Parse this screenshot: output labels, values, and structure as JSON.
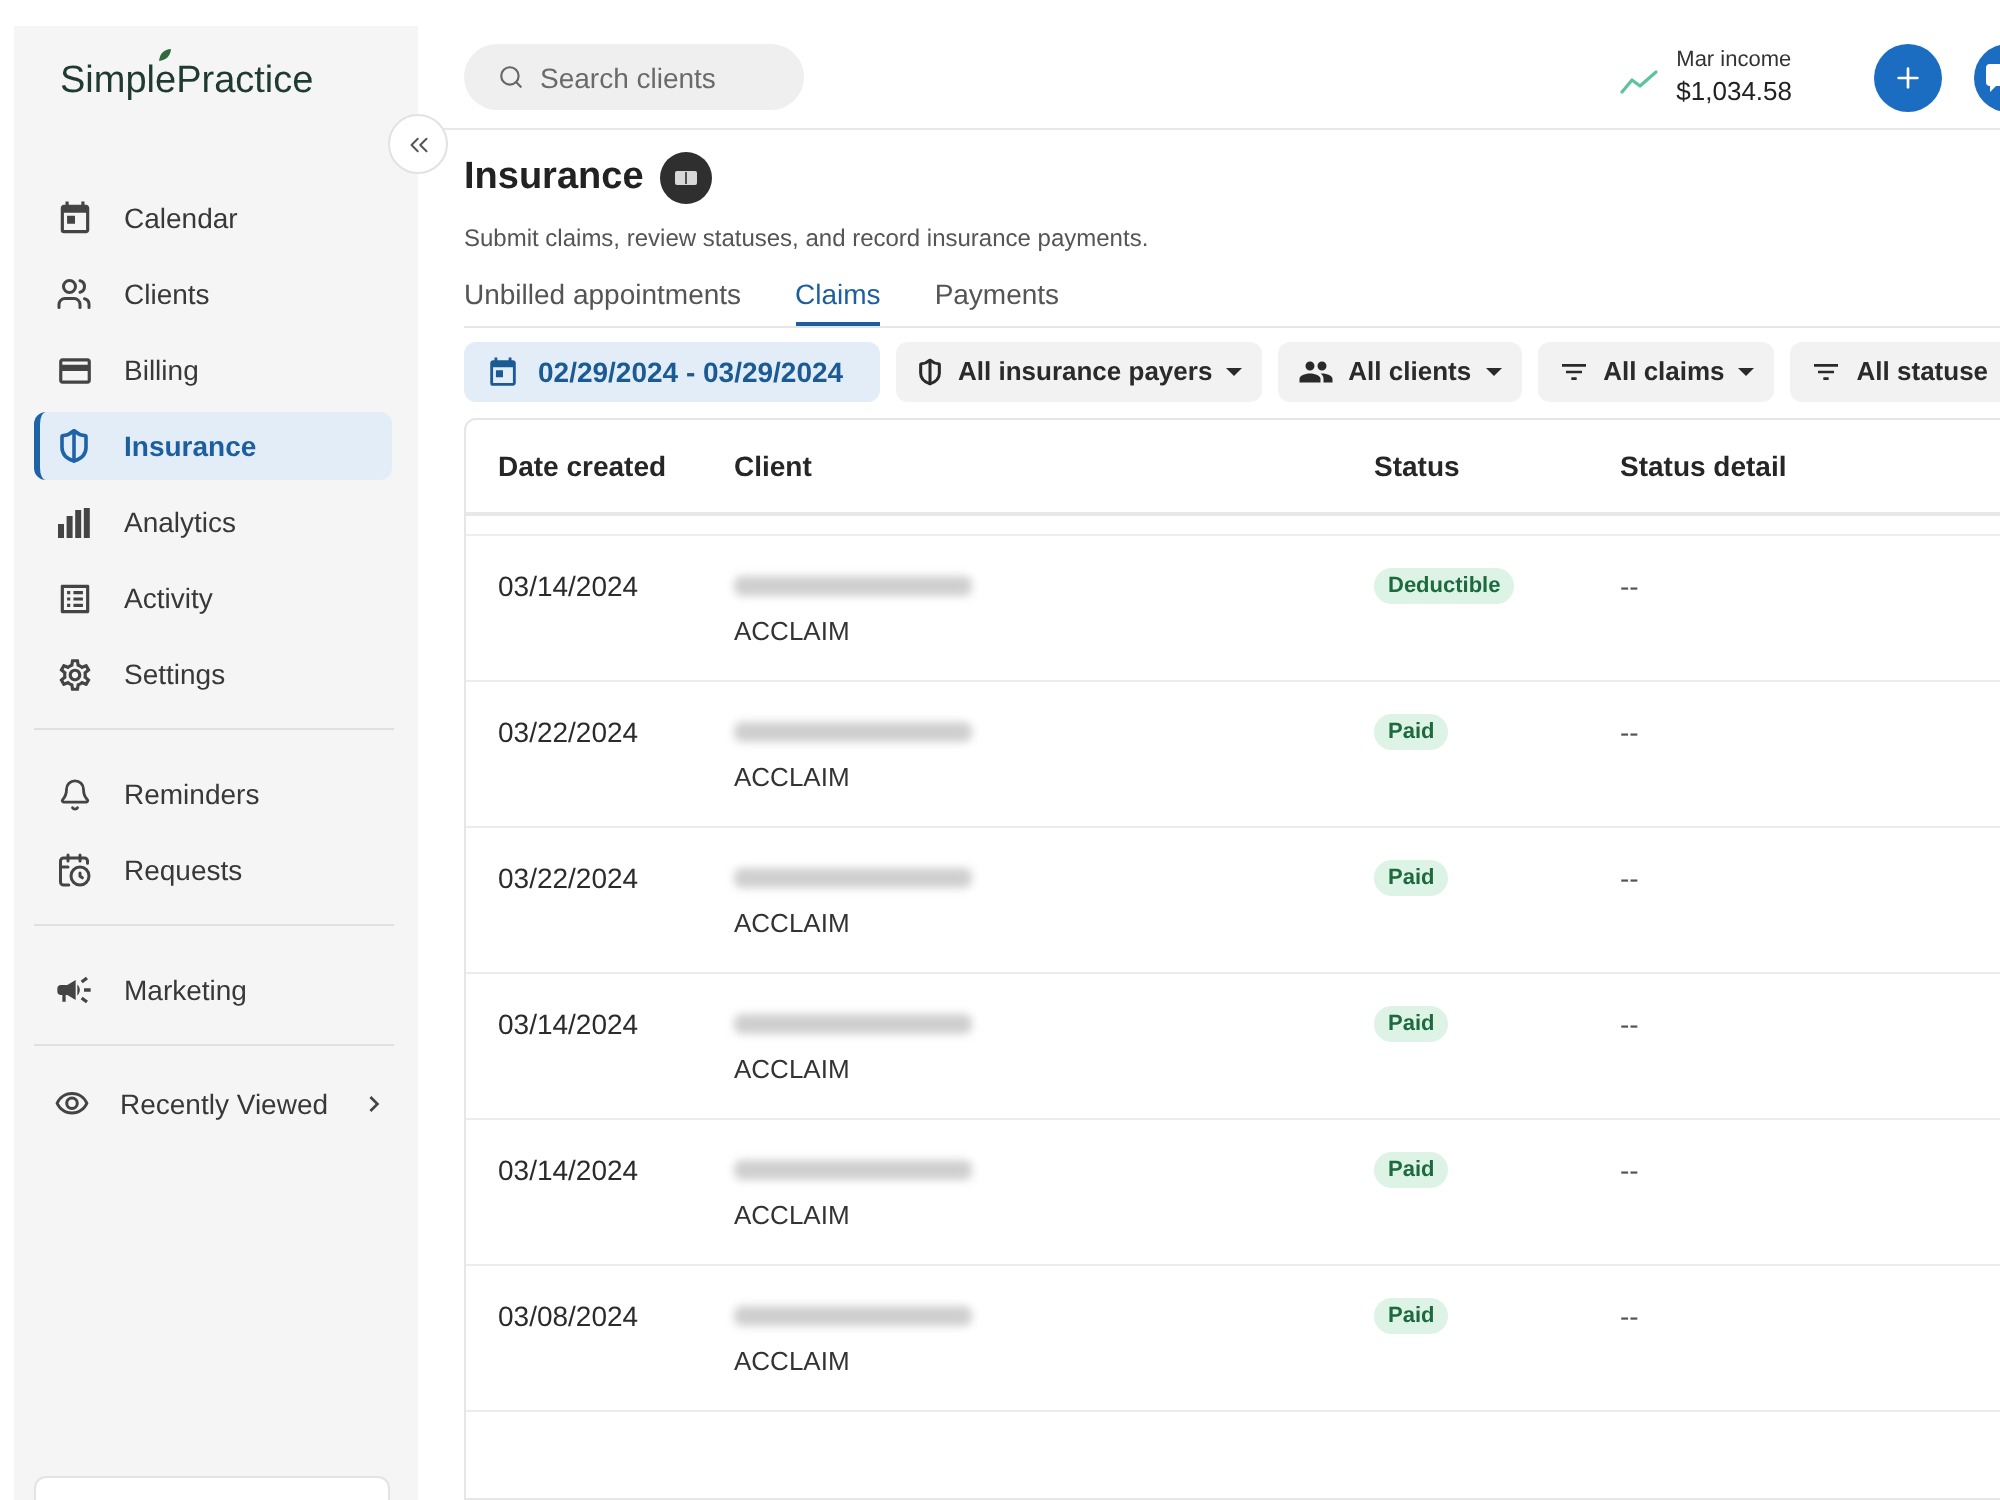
{
  "sidebar": {
    "logo": "SimplePractice",
    "sections": [
      {
        "items": [
          {
            "label": "Calendar",
            "selected": false
          },
          {
            "label": "Clients",
            "selected": false
          },
          {
            "label": "Billing",
            "selected": false
          },
          {
            "label": "Insurance",
            "selected": true
          },
          {
            "label": "Analytics",
            "selected": false
          },
          {
            "label": "Activity",
            "selected": false
          },
          {
            "label": "Settings",
            "selected": false
          }
        ]
      },
      {
        "items": [
          {
            "label": "Reminders",
            "selected": false
          },
          {
            "label": "Requests",
            "selected": false
          }
        ]
      },
      {
        "items": [
          {
            "label": "Marketing",
            "selected": false
          }
        ]
      }
    ],
    "recently_viewed": {
      "label": "Recently Viewed",
      "expanded": false
    }
  },
  "header": {
    "search": {
      "placeholder": "Search clients"
    },
    "income": {
      "label": "Mar income",
      "amount": "$1,034.58"
    }
  },
  "page": {
    "title": "Insurance",
    "subtitle": "Submit claims, review statuses, and record insurance payments."
  },
  "tabs": [
    {
      "label": "Unbilled appointments",
      "selected": false
    },
    {
      "label": "Claims",
      "selected": true
    },
    {
      "label": "Payments",
      "selected": false
    }
  ],
  "filters": [
    {
      "kind": "date",
      "label": "02/29/2024 - 03/29/2024"
    },
    {
      "kind": "payer",
      "label": "All insurance payers"
    },
    {
      "kind": "client",
      "label": "All clients"
    },
    {
      "kind": "filter",
      "label": "All claims"
    },
    {
      "kind": "filter",
      "label": "All statuse"
    }
  ],
  "table": {
    "columns": [
      "Date created",
      "Client",
      "Status",
      "Status detail"
    ],
    "rows": [
      {
        "date_created": "03/14/2024",
        "client_subtitle": "ACCLAIM",
        "status": "Deductible",
        "status_detail": "--"
      },
      {
        "date_created": "03/22/2024",
        "client_subtitle": "ACCLAIM",
        "status": "Paid",
        "status_detail": "--"
      },
      {
        "date_created": "03/22/2024",
        "client_subtitle": "ACCLAIM",
        "status": "Paid",
        "status_detail": "--"
      },
      {
        "date_created": "03/14/2024",
        "client_subtitle": "ACCLAIM",
        "status": "Paid",
        "status_detail": "--"
      },
      {
        "date_created": "03/14/2024",
        "client_subtitle": "ACCLAIM",
        "status": "Paid",
        "status_detail": "--"
      },
      {
        "date_created": "03/08/2024",
        "client_subtitle": "ACCLAIM",
        "status": "Paid",
        "status_detail": "--"
      }
    ]
  }
}
